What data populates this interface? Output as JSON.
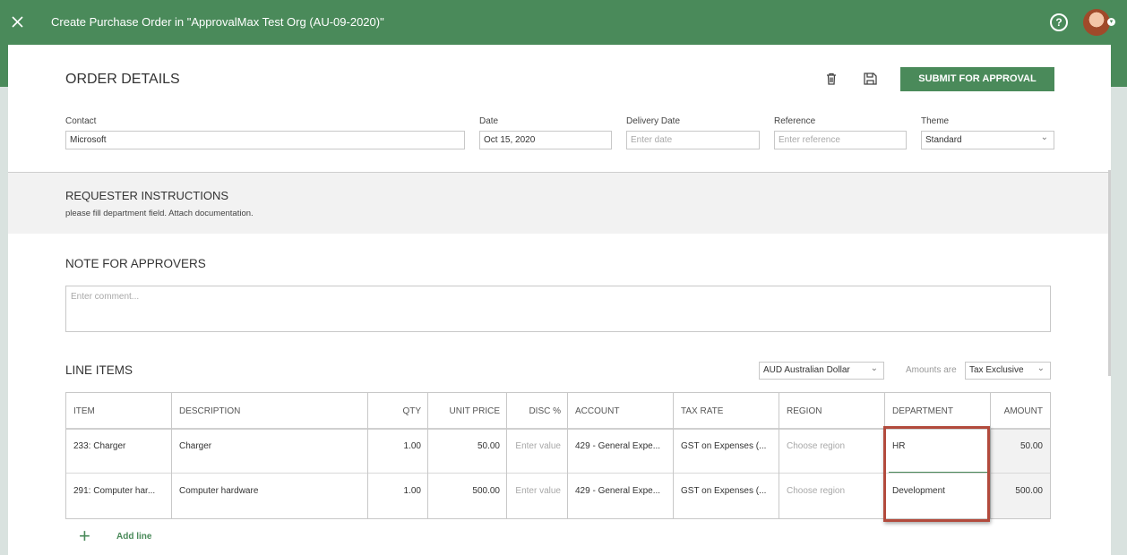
{
  "window": {
    "title": "Create Purchase Order in \"ApprovalMax Test Org (AU-09-2020)\"",
    "close_icon": "close-icon",
    "help_icon": "help-icon",
    "help_glyph": "?"
  },
  "order": {
    "heading": "ORDER DETAILS",
    "submit_label": "SUBMIT FOR APPROVAL",
    "fields": {
      "contact": {
        "label": "Contact",
        "value": "Microsoft"
      },
      "date": {
        "label": "Date",
        "value": "Oct 15, 2020"
      },
      "delivery_date": {
        "label": "Delivery Date",
        "placeholder": "Enter date"
      },
      "reference": {
        "label": "Reference",
        "placeholder": "Enter reference"
      },
      "theme": {
        "label": "Theme",
        "value": "Standard"
      }
    }
  },
  "instructions": {
    "heading": "REQUESTER INSTRUCTIONS",
    "text": "please fill department field. Attach documentation."
  },
  "note": {
    "heading": "NOTE FOR APPROVERS",
    "placeholder": "Enter comment..."
  },
  "line_items": {
    "heading": "LINE ITEMS",
    "currency": "AUD Australian Dollar",
    "amounts_label": "Amounts are",
    "amounts_mode": "Tax Exclusive",
    "columns": [
      "ITEM",
      "DESCRIPTION",
      "QTY",
      "UNIT PRICE",
      "DISC %",
      "ACCOUNT",
      "TAX RATE",
      "REGION",
      "DEPARTMENT",
      "AMOUNT"
    ],
    "rows": [
      {
        "item": "233: Charger",
        "description": "Charger",
        "qty": "1.00",
        "unit_price": "50.00",
        "disc": "Enter value",
        "account": "429 - General Expe...",
        "tax_rate": "GST on Expenses (...",
        "region": "Choose region",
        "department": "HR",
        "amount": "50.00"
      },
      {
        "item": "291: Computer har...",
        "description": "Computer hardware",
        "qty": "1.00",
        "unit_price": "500.00",
        "disc": "Enter value",
        "account": "429 - General Expe...",
        "tax_rate": "GST on Expenses (...",
        "region": "Choose region",
        "department": "Development",
        "amount": "500.00"
      }
    ],
    "add_line": "Add line"
  },
  "colors": {
    "brand_green": "#4a8a5a",
    "highlight_red": "#b24a3c"
  }
}
